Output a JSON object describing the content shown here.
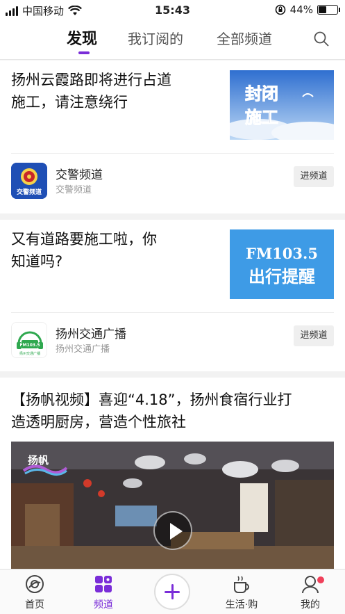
{
  "status_bar": {
    "carrier": "中国移动",
    "time": "15:43",
    "battery": "44%"
  },
  "nav": {
    "tabs": [
      {
        "label": "发现",
        "active": true
      },
      {
        "label": "我订阅的",
        "active": false
      },
      {
        "label": "全部频道",
        "active": false
      }
    ],
    "accent_color": "#7a2dd8"
  },
  "feed": [
    {
      "title_line1": "扬州云霞路即将进行占道",
      "title_line2": "施工，请注意绕行",
      "thumb_text_line1": "封闭",
      "thumb_text_line2": "施工",
      "channel_name": "交警频道",
      "channel_sub": "交警频道",
      "channel_logo_text": "交警频道",
      "join_label": "进频道"
    },
    {
      "title_line1": "又有道路要施工啦，你",
      "title_line2": "知道吗?",
      "thumb_text_line1": "FM103.5",
      "thumb_text_line2": "出行提醒",
      "channel_name": "扬州交通广播",
      "channel_sub": "扬州交通广播",
      "channel_logo_text": "FM103.5",
      "channel_logo_subtext": "扬州交通广播",
      "join_label": "进频道"
    },
    {
      "title_line1": "【扬帆视频】喜迎“4.18”，扬州食宿行业打",
      "title_line2": "造透明厨房，营造个性旅社",
      "video_logo_text": "扬帆"
    }
  ],
  "bottom_bar": {
    "items": [
      {
        "label": "首页",
        "icon": "home-icon",
        "active": false
      },
      {
        "label": "频道",
        "icon": "channels-icon",
        "active": true
      },
      {
        "label": "生活·购",
        "icon": "coffee-icon",
        "active": false
      },
      {
        "label": "我的",
        "icon": "profile-icon",
        "active": false
      }
    ]
  }
}
